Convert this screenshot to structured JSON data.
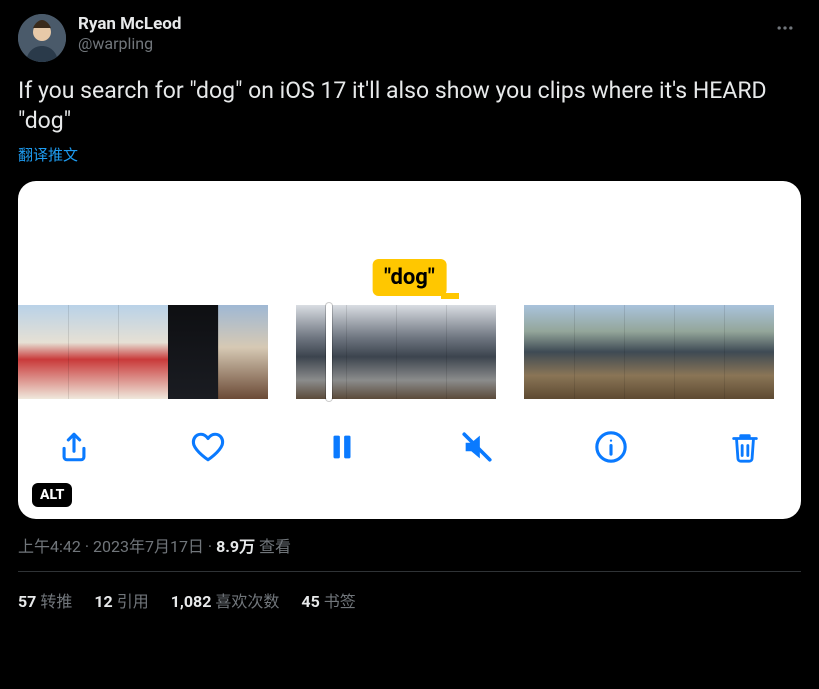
{
  "author": {
    "display_name": "Ryan McLeod",
    "handle": "@warpling"
  },
  "body_text": "If you search for \"dog\" on iOS 17 it'll also show you clips where it's HEARD \"dog\"",
  "translate_label": "翻译推文",
  "media": {
    "caption_text": "\"dog\"",
    "alt_badge": "ALT"
  },
  "meta": {
    "time": "上午4:42",
    "separator1": " · ",
    "date": "2023年7月17日",
    "separator2": " · ",
    "views_count": "8.9万",
    "views_label": " 查看"
  },
  "stats": {
    "retweets_count": "57",
    "retweets_label": "转推",
    "quotes_count": "12",
    "quotes_label": "引用",
    "likes_count": "1,082",
    "likes_label": "喜欢次数",
    "bookmarks_count": "45",
    "bookmarks_label": "书签"
  }
}
